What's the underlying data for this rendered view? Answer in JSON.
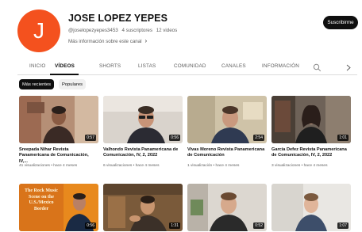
{
  "channel": {
    "avatar_letter": "J",
    "avatar_color": "#f4511e",
    "name": "JOSE LOPEZ YEPES",
    "handle": "@joselopezyepes3453",
    "subscribers": "4 suscriptores",
    "video_count": "12 videos",
    "more_info": "Más información sobre este canal",
    "subscribe_label": "Suscribirme"
  },
  "tabs": [
    {
      "label": "INICIO"
    },
    {
      "label": "VÍDEOS",
      "active": true
    },
    {
      "label": "SHORTS"
    },
    {
      "label": "LISTAS"
    },
    {
      "label": "COMUNIDAD"
    },
    {
      "label": "CANALES"
    },
    {
      "label": "INFORMACIÓN"
    }
  ],
  "chips": [
    {
      "label": "Más recientes",
      "active": true
    },
    {
      "label": "Populares",
      "active": false
    }
  ],
  "videos": [
    {
      "title": "Sreepada Nihar Revista Panamericana de Comunicación, IV,...",
      "meta": "41 visualizaciones • hace 4 meses",
      "duration": "0:57"
    },
    {
      "title": "Valhondo Revista Panamericana de Comunicación, IV, 2, 2022",
      "meta": "6 visualizaciones • hace 4 meses",
      "duration": "0:56"
    },
    {
      "title": "Vivas Moreno Revista Panamericana de Comunicación",
      "meta": "1 visualización • hace 4 meses",
      "duration": "2:54"
    },
    {
      "title": "García Defez Revista Panamericana de Comunicación, IV, 2, 2022",
      "meta": "3 visualizaciones • hace 4 meses",
      "duration": "1:01"
    },
    {
      "thumb_text": "The Rock Music Scene on the U.S./Mexico Border",
      "duration": "0:56"
    },
    {
      "duration": "1:31"
    },
    {
      "duration": "0:52"
    },
    {
      "duration": "1:07"
    }
  ],
  "colors": {
    "accent": "#0f0f0f",
    "secondary_text": "#606060",
    "duration_badge": "#000000"
  }
}
